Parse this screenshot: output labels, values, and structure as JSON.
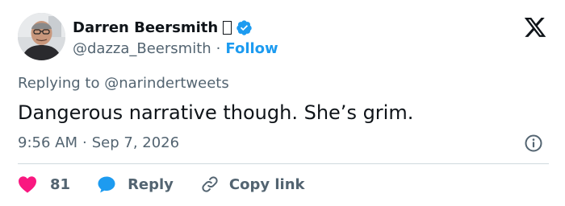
{
  "author": {
    "display_name": "Darren Beersmith",
    "emoji_placeholder": "tofu-box-icon",
    "verified_icon": "verified-badge-icon",
    "handle": "@dazza_Beersmith",
    "separator": "·",
    "follow_label": "Follow",
    "avatar_icon": "profile-photo"
  },
  "brand_icon": "x-logo-icon",
  "reply_context": {
    "prefix": "Replying to",
    "handle": "@narindertweets"
  },
  "tweet": {
    "text": "Dangerous narrative though. She’s grim.",
    "time": "9:56 AM",
    "separator": "·",
    "date": "Sep 7, 2026",
    "info_icon": "info-icon"
  },
  "actions": {
    "like_count": "81",
    "reply_label": "Reply",
    "copy_label": "Copy link"
  },
  "colors": {
    "accent": "#1d9bf0",
    "like": "#f91880",
    "text": "#0f1419",
    "muted": "#536471",
    "divider": "#cfd9de"
  }
}
